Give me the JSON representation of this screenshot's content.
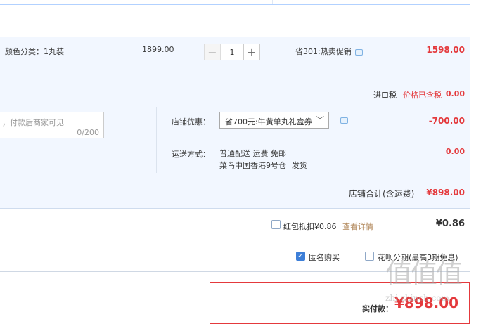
{
  "item": {
    "sku": "颜色分类：1丸装",
    "orig_price": "1899.00",
    "qty": "1",
    "promo": "省301:热卖促销",
    "subtotal": "1598.00"
  },
  "tax": {
    "label": "进口税",
    "note": "价格已含税",
    "value": "0.00"
  },
  "message": {
    "placeholder": "，付款后商家可见",
    "count": "0/200"
  },
  "shop_discount": {
    "label": "店铺优惠：",
    "selected": "省700元:牛黄单丸礼盒券",
    "value": "-700.00"
  },
  "shipping": {
    "label": "运送方式：",
    "method": "普通配送 运费 免邮",
    "warehouse": "菜鸟中国香港9号仓",
    "ship": "发货",
    "value": "0.00"
  },
  "shop_total": {
    "label": "店铺合计(含运费)",
    "value": "¥898.00"
  },
  "red_packet": {
    "label": "红包抵扣¥0.86",
    "link": "查看详情",
    "value": "¥0.86"
  },
  "options": {
    "anonymous": "匿名购买",
    "huabei": "花呗分期(最高3期免息)"
  },
  "payment": {
    "label": "实付款：",
    "value": "¥898.00"
  },
  "watermark": {
    "glyphs": "值值值",
    "url": "zhi.zhinch.com"
  },
  "colors": {
    "accent_red": "#e4393c",
    "panel_bg": "#f2f7ff",
    "link_brown": "#b38a5e"
  }
}
